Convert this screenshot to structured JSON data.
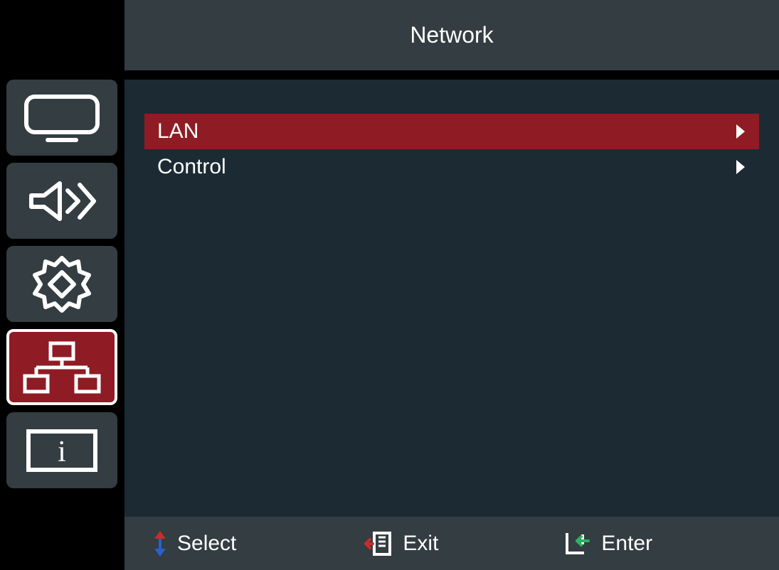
{
  "title": "Network",
  "colors": {
    "panel": "#333d42",
    "main": "#1c2a33",
    "accent": "#8f1c24",
    "text": "#ffffff"
  },
  "sidebar": {
    "items": [
      {
        "name": "display",
        "icon": "monitor-icon",
        "active": false
      },
      {
        "name": "audio",
        "icon": "speaker-icon",
        "active": false
      },
      {
        "name": "settings",
        "icon": "gear-icon",
        "active": false
      },
      {
        "name": "network",
        "icon": "network-icon",
        "active": true
      },
      {
        "name": "info",
        "icon": "info-icon",
        "active": false
      }
    ]
  },
  "menu": {
    "items": [
      {
        "label": "LAN",
        "selected": true
      },
      {
        "label": "Control",
        "selected": false
      }
    ]
  },
  "footer": {
    "select_label": "Select",
    "exit_label": "Exit",
    "enter_label": "Enter"
  }
}
